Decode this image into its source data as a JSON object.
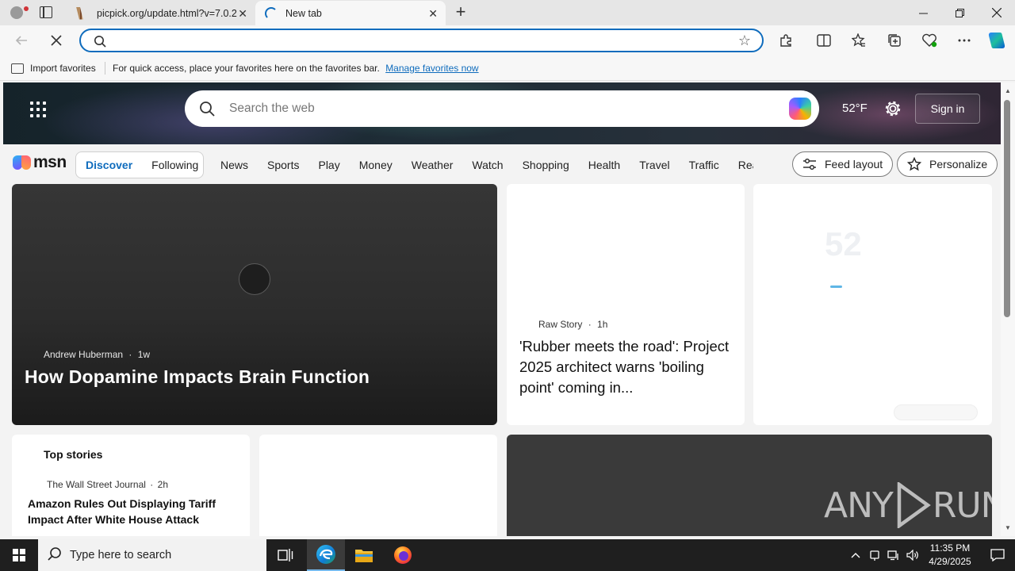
{
  "browser": {
    "tabs": [
      {
        "title": "picpick.org/update.html?v=7.0.2",
        "active": false
      },
      {
        "title": "New tab",
        "active": true
      }
    ],
    "address": {
      "value": "",
      "placeholder": ""
    },
    "favorites_bar": {
      "import_label": "Import favorites",
      "message": "For quick access, place your favorites here on the favorites bar.",
      "manage_link": "Manage favorites now"
    }
  },
  "msn": {
    "search_placeholder": "Search the web",
    "temperature": "52°F",
    "sign_in": "Sign in",
    "logo_text": "msn",
    "feed_tabs": [
      {
        "label": "Discover",
        "active": true
      },
      {
        "label": "Following",
        "active": false
      }
    ],
    "categories": [
      "News",
      "Sports",
      "Play",
      "Money",
      "Weather",
      "Watch",
      "Shopping",
      "Health",
      "Travel",
      "Traffic",
      "Real Estate"
    ],
    "feed_layout_label": "Feed layout",
    "personalize_label": "Personalize"
  },
  "cards": {
    "hero_story": {
      "source": "Andrew Huberman",
      "age": "1w",
      "title": "How Dopamine Impacts Brain Function"
    },
    "second_story": {
      "source": "Raw Story",
      "age": "1h",
      "title": "'Rubber meets the road': Project 2025 architect warns 'boiling point' coming in..."
    },
    "weather_widget": {
      "temp_ghost": "52"
    },
    "top_stories": {
      "header": "Top stories",
      "source": "The Wall Street Journal",
      "age": "2h",
      "title": "Amazon Rules Out Displaying Tariff Impact After White House Attack"
    },
    "watermark": {
      "left": "ANY",
      "right": "RUN"
    }
  },
  "taskbar": {
    "search_placeholder": "Type here to search",
    "time": "11:35 PM",
    "date": "4/29/2025"
  },
  "colors": {
    "accent": "#0f6cbd",
    "taskbar": "#1f1f1f"
  }
}
